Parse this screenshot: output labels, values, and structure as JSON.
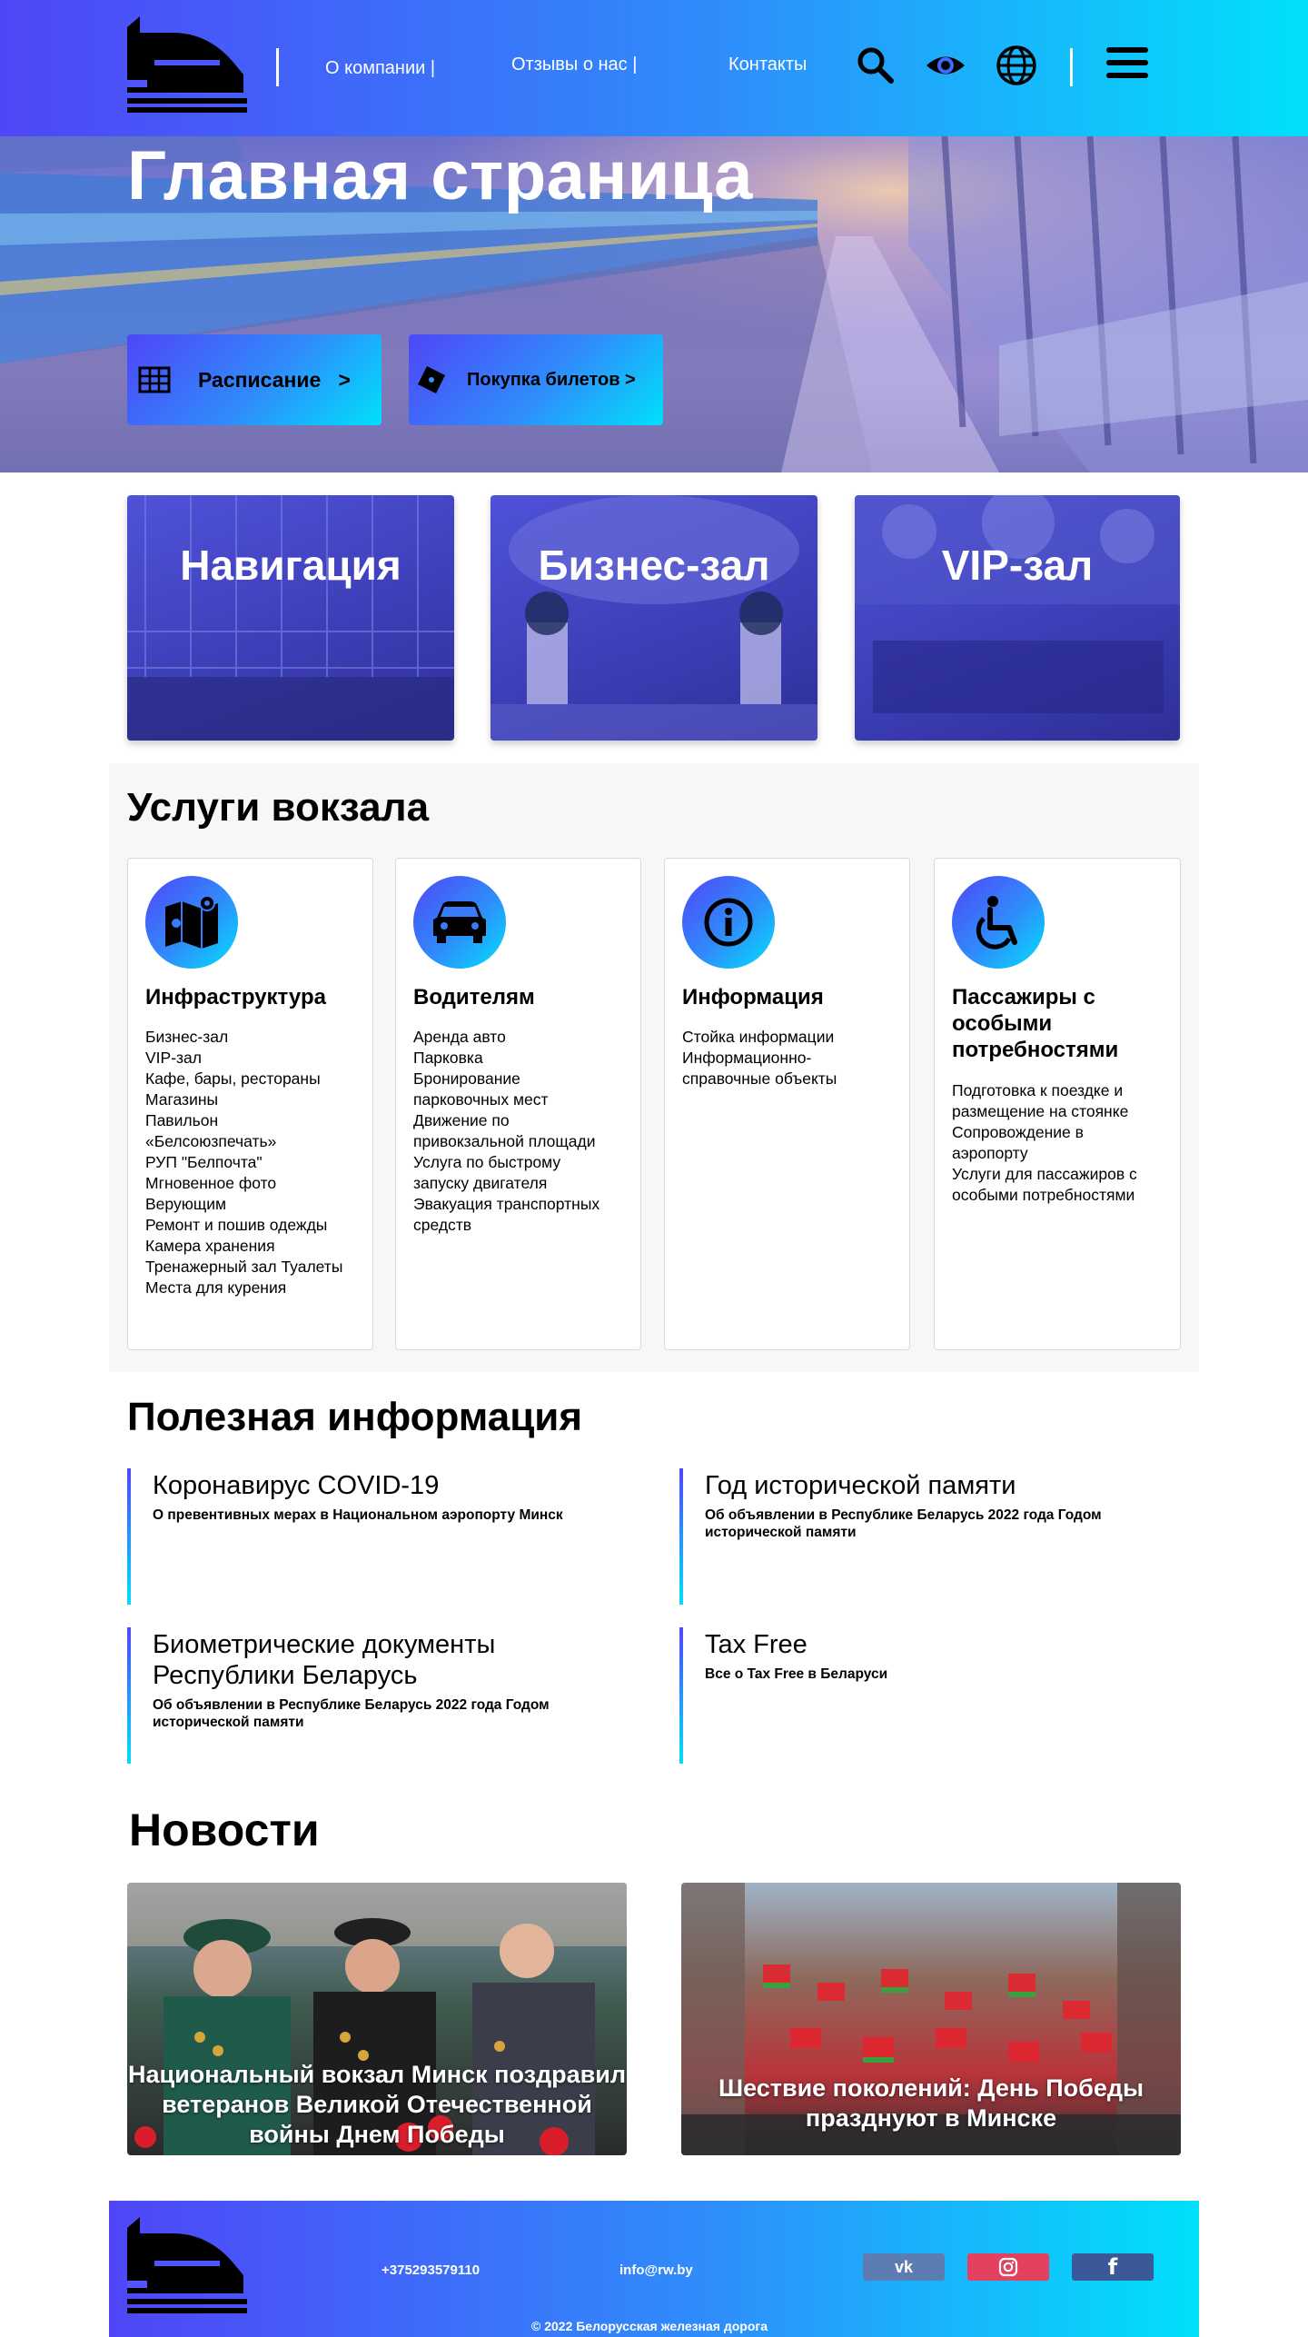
{
  "colors": {
    "gradient_start": "#4f46f7",
    "gradient_mid": "#2f8dfb",
    "gradient_end": "#00e0fb",
    "vk": "#5b7db1",
    "instagram": "#e4405f",
    "facebook": "#3b5998"
  },
  "header": {
    "nav": [
      "О компании |",
      "Отзывы о нас |",
      "Контакты"
    ],
    "icons": [
      "search-icon",
      "eye-icon",
      "globe-icon",
      "menu-icon"
    ]
  },
  "hero": {
    "title": "Главная страница",
    "buttons": [
      {
        "label": "Расписание   >",
        "icon": "table-icon"
      },
      {
        "label": "Покупка билетов >",
        "icon": "ticket-icon"
      }
    ]
  },
  "promo_cards": [
    "Навигация",
    "Бизнес-зал",
    "VIP-зал"
  ],
  "services": {
    "title": "Услуги вокзала",
    "items": [
      {
        "icon": "map-icon",
        "title": "Инфраструктура",
        "lines": [
          "Бизнес-зал",
          "VIP-зал",
          "Кафе, бары, рестораны",
          "Магазины",
          "Павильон",
          "«Белсоюзпечать»",
          "РУП \"Белпочта\"",
          "Мгновенное фото",
          "Верующим",
          "Ремонт и пошив одежды",
          "Камера хранения",
          "Тренажерный зал Туалеты",
          "Места для курения"
        ]
      },
      {
        "icon": "car-icon",
        "title": "Водителям",
        "lines": [
          "Аренда авто",
          "Парковка",
          "Бронирование",
          "парковочных мест",
          "Движение по",
          "привокзальной площади",
          "Услуга по быстрому",
          "запуску двигателя",
          "Эвакуация транспортных",
          "средств"
        ]
      },
      {
        "icon": "info-icon",
        "title": "Информация",
        "lines": [
          "Стойка информации",
          "Информационно-",
          "справочные объекты"
        ]
      },
      {
        "icon": "wheelchair-icon",
        "title": "Пассажиры с особыми потребностями",
        "lines": [
          "Подготовка к поездке и",
          "размещение на стоянке",
          "Сопровождение в",
          "аэропорту",
          "Услуги для пассажиров с",
          "особыми потребностями"
        ]
      }
    ]
  },
  "useful": {
    "title": "Полезная информация",
    "items": [
      {
        "title": "Коронавирус COVID-19",
        "desc": "О превентивных мерах в Национальном аэропорту Минск"
      },
      {
        "title": "Год исторической памяти",
        "desc": "Об объявлении в Республике Беларусь 2022 года Годом исторической памяти"
      },
      {
        "title": "Биометрические документы Республики Беларусь",
        "desc": "Об объявлении в Республике Беларусь 2022 года Годом исторической памяти"
      },
      {
        "title": "Tax Free",
        "desc": "Все о Tax Free в Беларуси"
      }
    ]
  },
  "news": {
    "title": "Новости",
    "items": [
      {
        "title": "Национальный вокзал Минск поздравил ветеранов Великой Отечественной войны Днем Победы"
      },
      {
        "title": "Шествие поколений: День Победы празднуют в Минске"
      }
    ]
  },
  "footer": {
    "phone": "+375293579110",
    "email": "info@rw.by",
    "social": [
      "vk-icon",
      "instagram-icon",
      "facebook-icon"
    ],
    "social_labels": [
      "vk",
      "",
      "f"
    ],
    "copyright": "© 2022 Белорусская железная дорога"
  }
}
